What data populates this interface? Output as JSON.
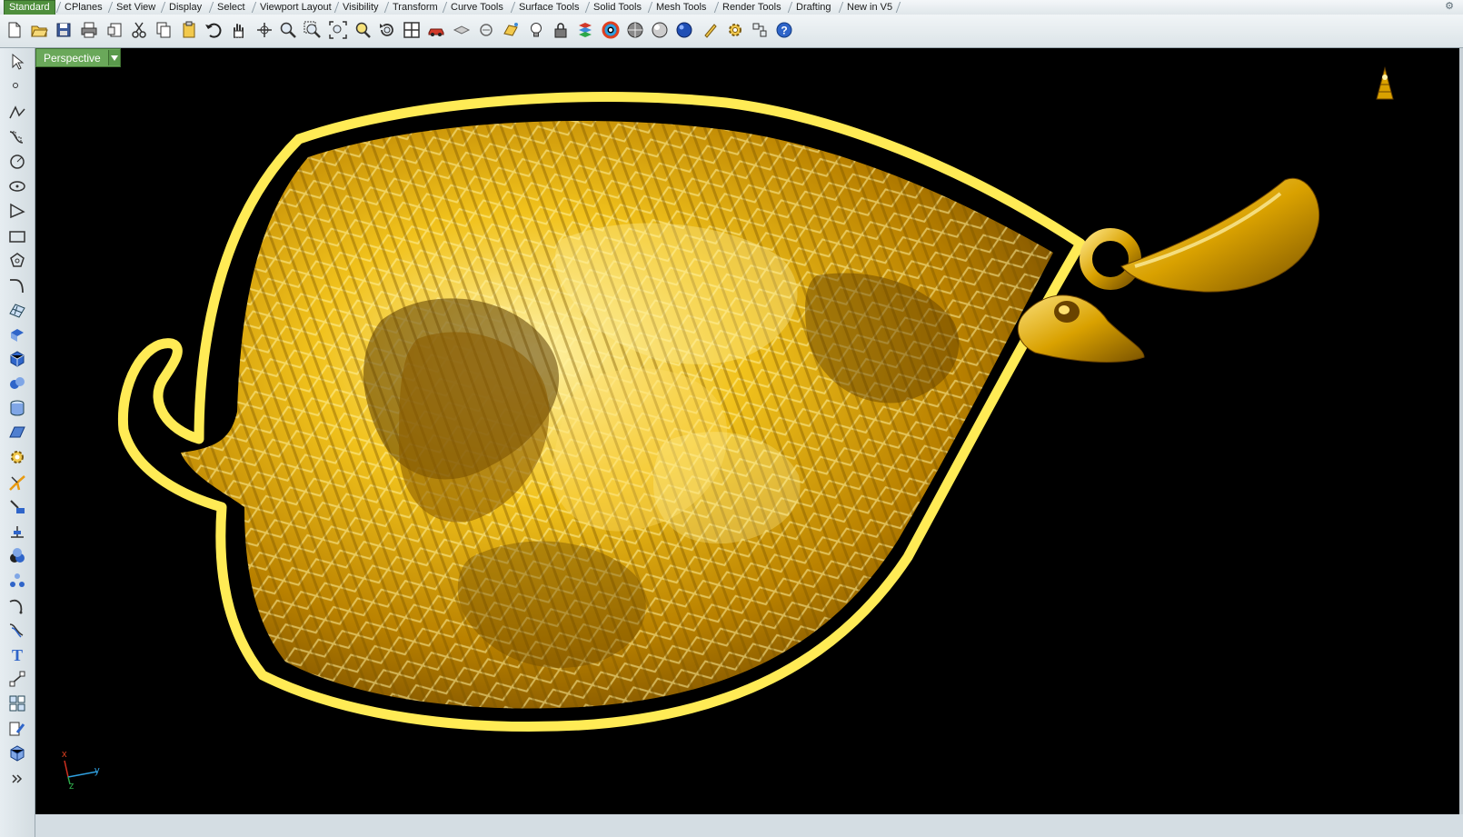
{
  "tabs": [
    {
      "label": "Standard",
      "active": true
    },
    {
      "label": "CPlanes"
    },
    {
      "label": "Set View"
    },
    {
      "label": "Display"
    },
    {
      "label": "Select"
    },
    {
      "label": "Viewport Layout"
    },
    {
      "label": "Visibility"
    },
    {
      "label": "Transform"
    },
    {
      "label": "Curve Tools"
    },
    {
      "label": "Surface Tools"
    },
    {
      "label": "Solid Tools"
    },
    {
      "label": "Mesh Tools"
    },
    {
      "label": "Render Tools"
    },
    {
      "label": "Drafting"
    },
    {
      "label": "New in V5"
    }
  ],
  "toolbar_icons": [
    "new-file",
    "open-file",
    "save",
    "print",
    "import",
    "cut",
    "copy",
    "paste",
    "undo",
    "pan-hand",
    "rotate-view",
    "zoom",
    "zoom-window",
    "zoom-extents",
    "zoom-selected",
    "rotate-reset",
    "four-viewports",
    "car-icon",
    "hide-object",
    "show-object",
    "cplane",
    "light-bulb",
    "lock",
    "layer",
    "color-wheel",
    "render-sphere-gray",
    "render-sphere-white",
    "render-sphere-blue",
    "material-edit",
    "options-gear",
    "grid-snap",
    "help"
  ],
  "left_tools": [
    "select-arrow",
    "point",
    "polyline",
    "curve",
    "circle",
    "arc",
    "polygon",
    "rectangle",
    "ellipse",
    "blend-curve",
    "surface-grid",
    "extrude",
    "box",
    "boolean",
    "cylinder",
    "plane-surface",
    "transform-gear",
    "explode",
    "join",
    "dimension",
    "boolean-union",
    "points-on",
    "fillet-curve",
    "offset",
    "text",
    "rebuild",
    "group",
    "properties",
    "block",
    "more"
  ],
  "viewport": {
    "label": "Perspective",
    "dropdown_icon": "chevron-down-icon",
    "axis_labels": {
      "x": "x",
      "y": "y",
      "z": "z"
    }
  },
  "colors": {
    "accent": "#4f8f3d",
    "gold": "#e3b21a",
    "outline": "#ffeb55"
  }
}
